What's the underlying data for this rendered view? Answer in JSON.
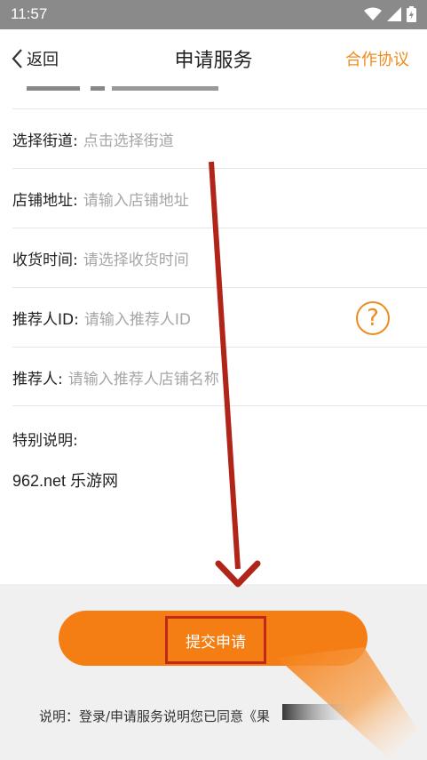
{
  "status_bar": {
    "time": "11:57",
    "icons": [
      "wifi-icon",
      "signal-icon",
      "battery-icon"
    ]
  },
  "header": {
    "back_label": "返回",
    "title": "申请服务",
    "agreement_label": "合作协议"
  },
  "form": {
    "fields": [
      {
        "label": "选择街道:",
        "placeholder": "点击选择街道"
      },
      {
        "label": "店铺地址:",
        "placeholder": "请输入店铺地址"
      },
      {
        "label": "收货时间:",
        "placeholder": "请选择收货时间"
      },
      {
        "label": "推荐人ID:",
        "placeholder": "请输入推荐人ID"
      },
      {
        "label": "推荐人:",
        "placeholder": "请输入推荐人店铺名称"
      }
    ],
    "special": {
      "label": "特别说明:",
      "content": "962.net 乐游网"
    }
  },
  "footer": {
    "submit_label": "提交申请",
    "note": "说明：登录/申请服务说明您已同意《果"
  },
  "colors": {
    "accent": "#f57e14",
    "highlight_box": "#c0281c",
    "arrow": "#b0241a"
  }
}
